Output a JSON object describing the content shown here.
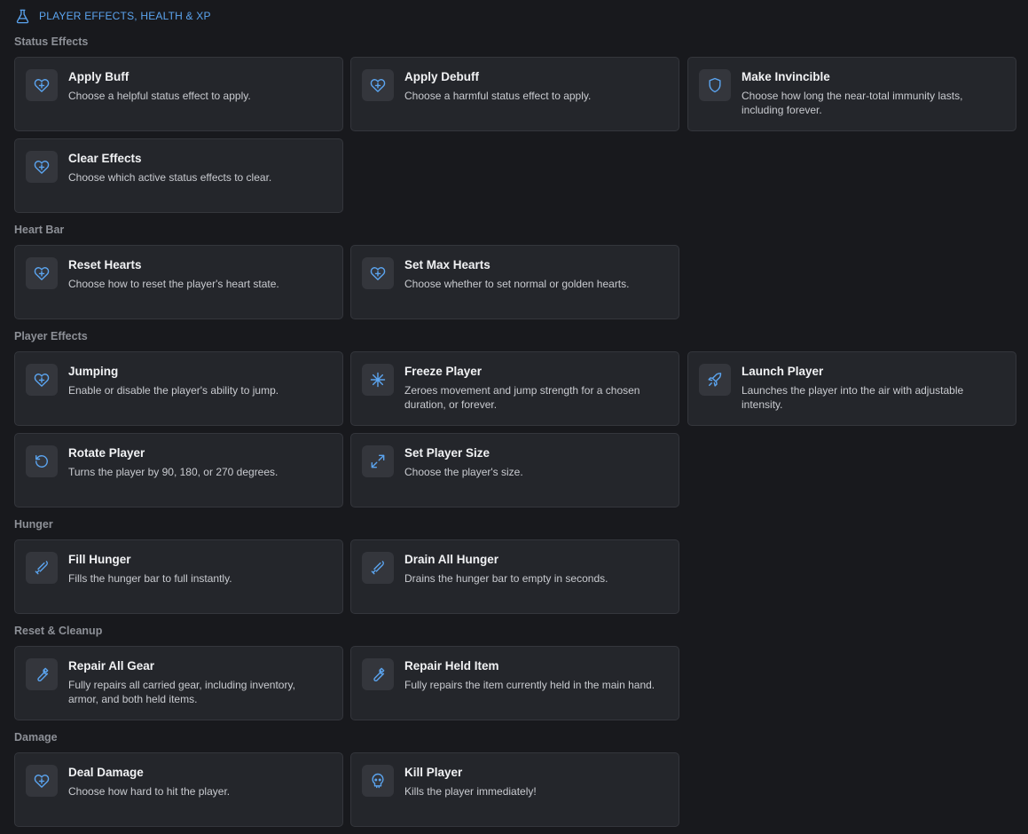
{
  "header": {
    "title": "PLAYER EFFECTS, HEALTH & XP",
    "icon": "flask-icon",
    "accent": "#5ba4ef"
  },
  "sections": {
    "status": {
      "title": "Status Effects",
      "apply_buff": {
        "title": "Apply Buff",
        "desc": "Choose a helpful status effect to apply.",
        "icon": "heart-plus-icon"
      },
      "apply_debuff": {
        "title": "Apply Debuff",
        "desc": "Choose a harmful status effect to apply.",
        "icon": "heart-plus-icon"
      },
      "make_invincible": {
        "title": "Make Invincible",
        "desc": "Choose how long the near-total immunity lasts, including forever.",
        "icon": "shield-icon"
      },
      "clear_effects": {
        "title": "Clear Effects",
        "desc": "Choose which active status effects to clear.",
        "icon": "heart-plus-icon"
      }
    },
    "heart_bar": {
      "title": "Heart Bar",
      "reset_hearts": {
        "title": "Reset Hearts",
        "desc": "Choose how to reset the player's heart state.",
        "icon": "heart-plus-icon"
      },
      "set_max_hearts": {
        "title": "Set Max Hearts",
        "desc": "Choose whether to set normal or golden hearts.",
        "icon": "heart-plus-icon"
      }
    },
    "player_effects": {
      "title": "Player Effects",
      "jumping": {
        "title": "Jumping",
        "desc": "Enable or disable the player's ability to jump.",
        "icon": "heart-plus-icon"
      },
      "freeze_player": {
        "title": "Freeze Player",
        "desc": "Zeroes movement and jump strength for a chosen duration, or forever.",
        "icon": "snowflake-icon"
      },
      "launch_player": {
        "title": "Launch Player",
        "desc": "Launches the player into the air with adjustable intensity.",
        "icon": "rocket-icon"
      },
      "rotate_player": {
        "title": "Rotate Player",
        "desc": "Turns the player by 90, 180, or 270 degrees.",
        "icon": "rotate-icon"
      },
      "set_player_size": {
        "title": "Set Player Size",
        "desc": "Choose the player's size.",
        "icon": "expand-icon"
      }
    },
    "hunger": {
      "title": "Hunger",
      "fill_hunger": {
        "title": "Fill Hunger",
        "desc": "Fills the hunger bar to full instantly.",
        "icon": "drumstick-icon"
      },
      "drain_all_hunger": {
        "title": "Drain All Hunger",
        "desc": "Drains the hunger bar to empty in seconds.",
        "icon": "drumstick-icon"
      }
    },
    "reset_cleanup": {
      "title": "Reset & Cleanup",
      "repair_all_gear": {
        "title": "Repair All Gear",
        "desc": "Fully repairs all carried gear, including inventory, armor, and both held items.",
        "icon": "wrench-icon"
      },
      "repair_held_item": {
        "title": "Repair Held Item",
        "desc": "Fully repairs the item currently held in the main hand.",
        "icon": "wrench-icon"
      }
    },
    "damage": {
      "title": "Damage",
      "deal_damage": {
        "title": "Deal Damage",
        "desc": "Choose how hard to hit the player.",
        "icon": "heart-plus-icon"
      },
      "kill_player": {
        "title": "Kill Player",
        "desc": "Kills the player immediately!",
        "icon": "skull-icon"
      }
    }
  }
}
